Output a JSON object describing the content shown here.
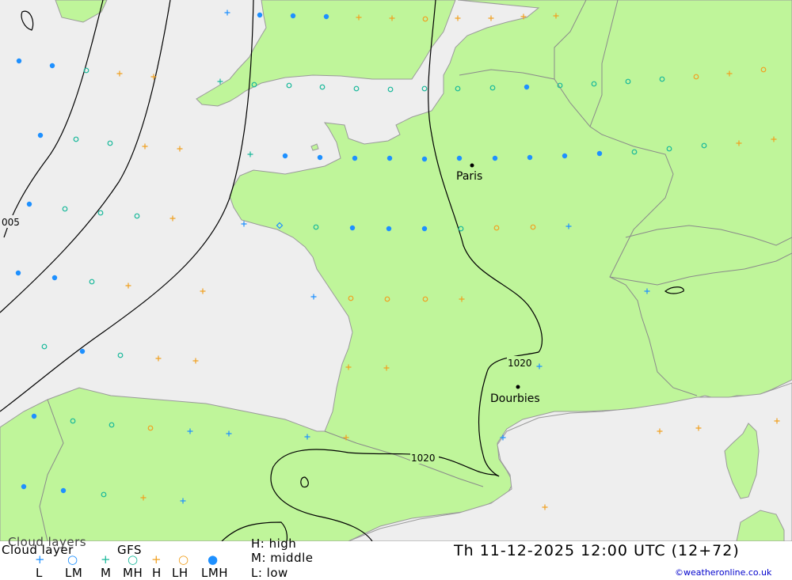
{
  "map": {
    "cities": [
      {
        "name": "Paris"
      },
      {
        "name": "Dourbies"
      }
    ],
    "isobar_labels": [
      "005",
      "1020",
      "1020"
    ]
  },
  "legend": {
    "title_shadow": "Cloud layers",
    "title": "Cloud layer",
    "model": "GFS",
    "codes": [
      "L",
      "LM",
      "M",
      "MH",
      "H",
      "LH",
      "LMH"
    ],
    "key_high": "H: high",
    "key_middle": "M: middle",
    "key_low": "L: low",
    "datetime": "Th 11-12-2025 12:00 UTC (12+72)",
    "credit": "©weatheronline.co.uk"
  },
  "colors": {
    "land": "#bff59a",
    "sea": "#eeeeee",
    "border": "#9a9a9a",
    "isobar": "#000000",
    "low": "#1e90ff",
    "middle": "#18b89a",
    "high": "#f0a020"
  }
}
